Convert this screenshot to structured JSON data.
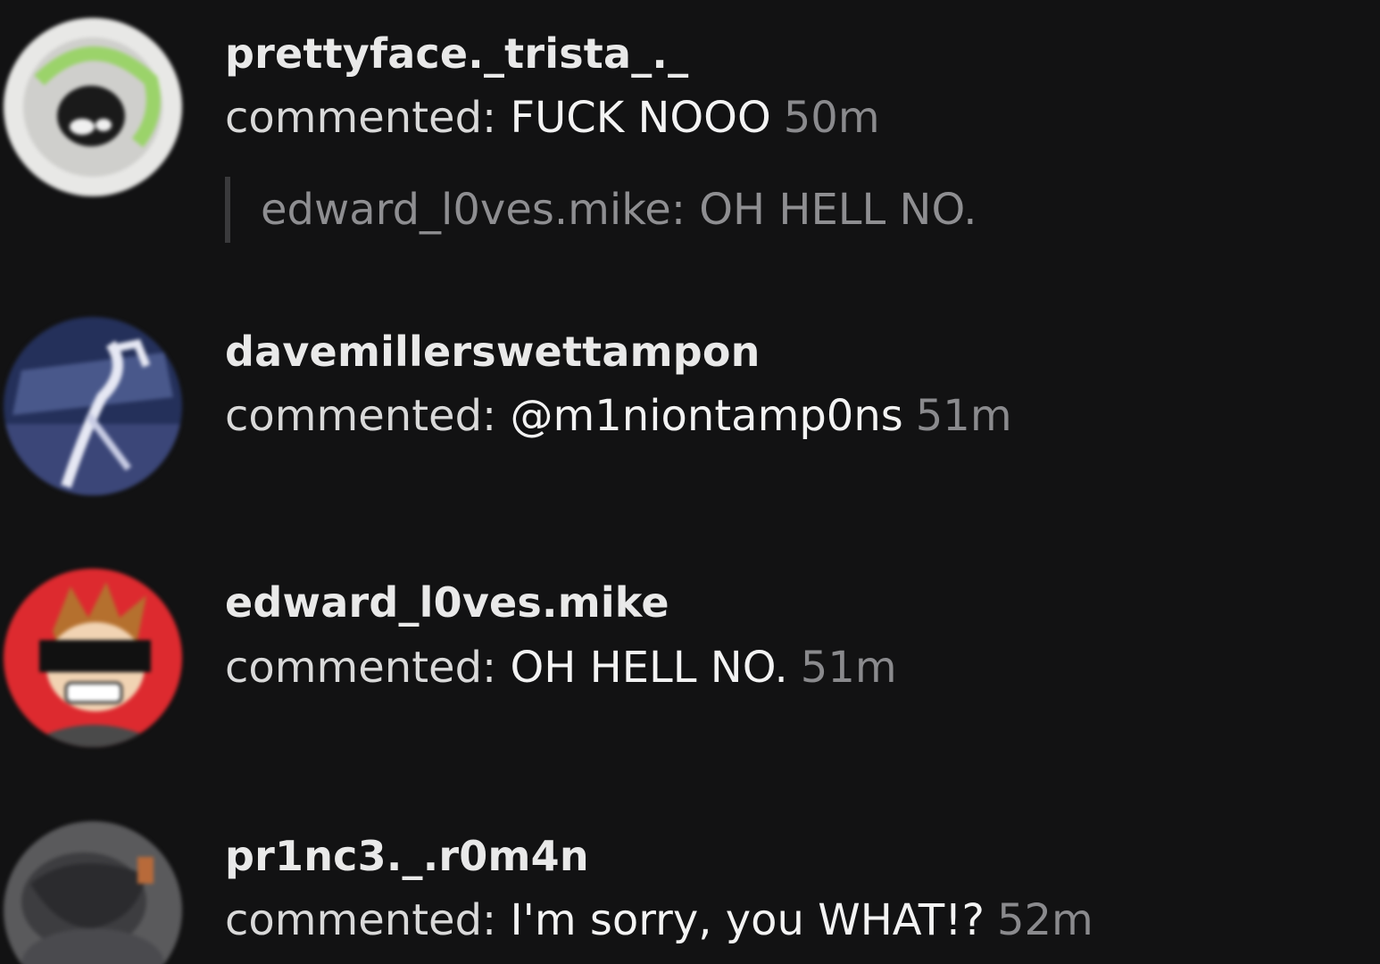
{
  "notifications": [
    {
      "username": "prettyface._trista_._",
      "prefix": "commented:",
      "text": "FUCK NOOO",
      "time": "50m",
      "reply_to": "edward_l0ves.mike: OH HELL NO."
    },
    {
      "username": "davemillerswettampon",
      "prefix": "commented:",
      "text": "@m1niontamp0ns",
      "time": "51m"
    },
    {
      "username": "edward_l0ves.mike",
      "prefix": "commented:",
      "text": "OH HELL NO.",
      "time": "51m"
    },
    {
      "username": "pr1nc3._.r0m4n",
      "prefix": "commented:",
      "text": "I'm sorry, you WHAT!?",
      "time": "52m"
    }
  ],
  "colors": {
    "background": "#121213",
    "text": "#f3f3f3",
    "muted": "#8a8a8d"
  }
}
